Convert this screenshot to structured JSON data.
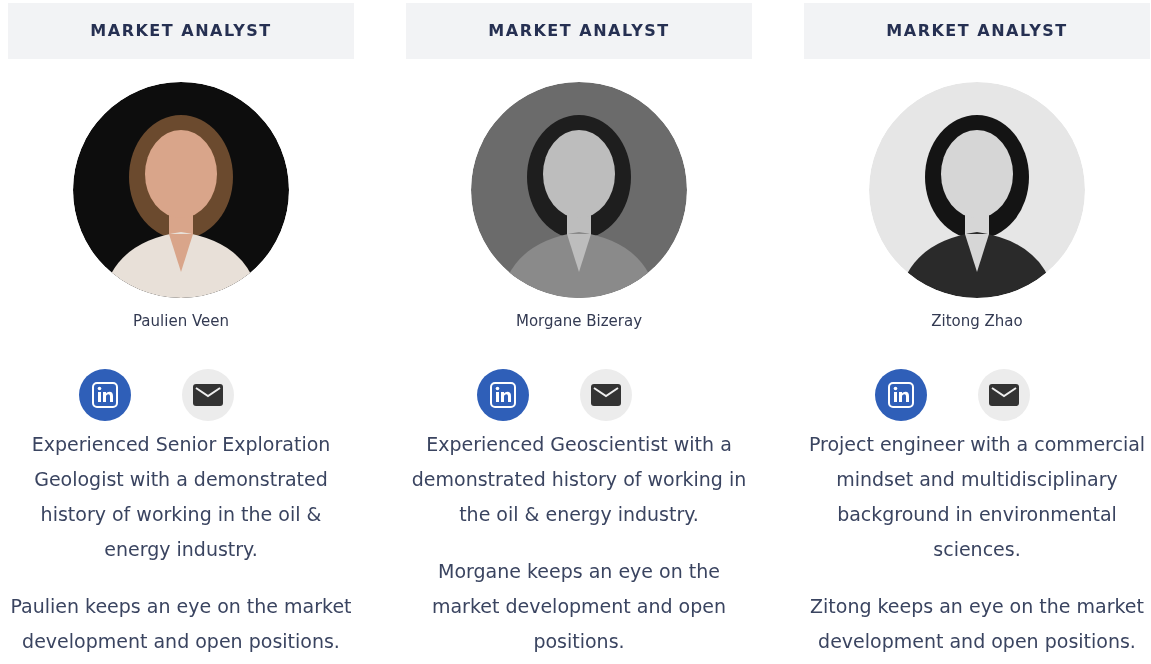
{
  "team": [
    {
      "role": "MARKET ANALYST",
      "name": "Paulien Veen",
      "bio": [
        "Experienced Senior Exploration Geologist with a demonstrated history of working in the oil & energy industry.",
        "Paulien keeps an eye on the market development and open positions."
      ]
    },
    {
      "role": "MARKET ANALYST",
      "name": "Morgane Bizeray",
      "bio": [
        "Experienced Geoscientist with a demonstrated history of working in the oil & energy industry.",
        "Morgane keeps an eye on the market development and open positions."
      ]
    },
    {
      "role": "MARKET ANALYST",
      "name": "Zitong Zhao",
      "bio": [
        "Project engineer with a commercial mindset and multidisciplinary background in environmental sciences.",
        "Zitong keeps an eye on the market development and open positions."
      ]
    }
  ]
}
